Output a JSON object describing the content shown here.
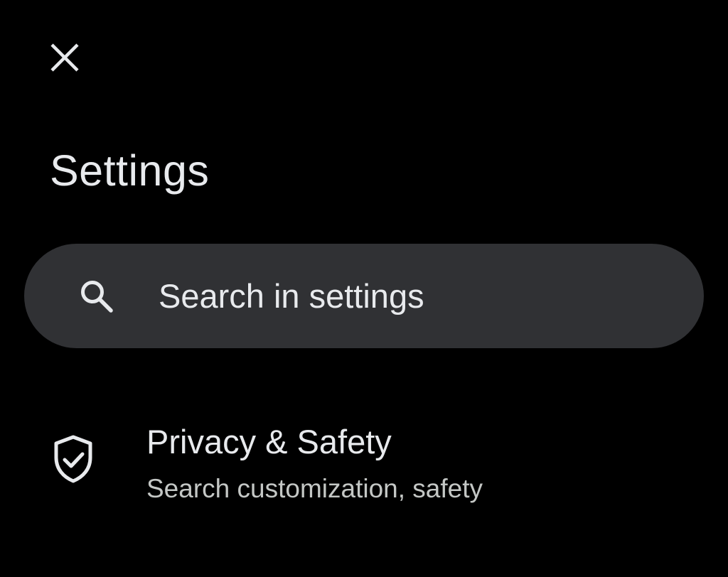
{
  "header": {
    "close_icon": "close-icon",
    "title": "Settings"
  },
  "search": {
    "icon": "search-icon",
    "placeholder": "Search in settings"
  },
  "items": [
    {
      "icon": "shield-check-icon",
      "title": "Privacy & Safety",
      "subtitle": "Search customization, safety"
    }
  ],
  "colors": {
    "background": "#000000",
    "search_bar": "#303134",
    "primary_text": "#e8eaed",
    "secondary_text": "#c4c7c5"
  }
}
